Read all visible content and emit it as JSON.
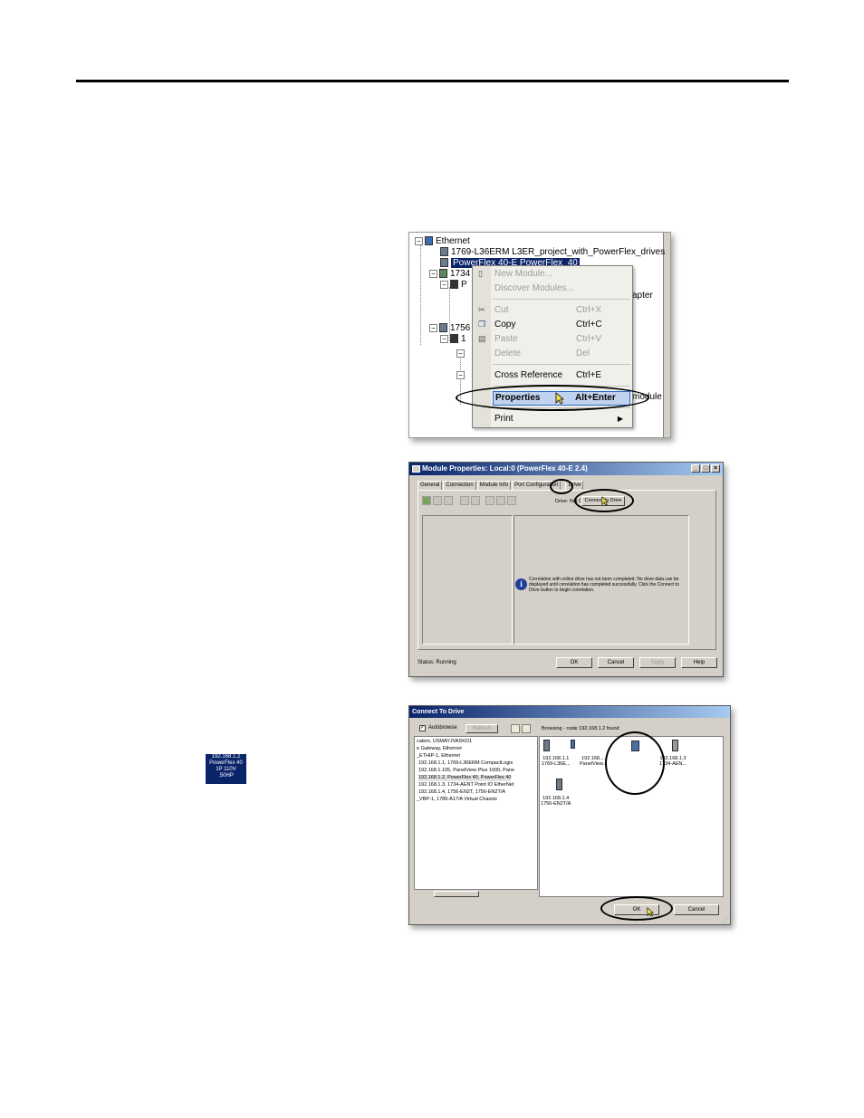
{
  "tree": {
    "rows": [
      "Ethernet",
      "1769-L36ERM L3ER_project_with_PowerFlex_drives",
      "PowerFlex 40-E PowerFlex_40",
      "1734",
      "P",
      "apter",
      "1756",
      "1",
      "module"
    ]
  },
  "context_menu": {
    "items": [
      {
        "label": "New Module...",
        "shortcut": ""
      },
      {
        "label": "Discover Modules...",
        "shortcut": ""
      },
      {
        "label": "Cut",
        "shortcut": "Ctrl+X"
      },
      {
        "label": "Copy",
        "shortcut": "Ctrl+C"
      },
      {
        "label": "Paste",
        "shortcut": "Ctrl+V"
      },
      {
        "label": "Delete",
        "shortcut": "Del"
      },
      {
        "label": "Cross Reference",
        "shortcut": "Ctrl+E"
      },
      {
        "label": "Properties",
        "shortcut": "Alt+Enter"
      },
      {
        "label": "Print",
        "shortcut": ""
      }
    ]
  },
  "module_properties": {
    "title": "Module Properties: Local:0 (PowerFlex 40-E 2.4)",
    "tabs": [
      "General",
      "Connection",
      "Module Info",
      "Port Configuration",
      "Drive"
    ],
    "drive_status": "Drive: Not Connected",
    "connect_button": "Connect to Drive",
    "info_message": "Correlation with online drive has not been completed. No drive data can be displayed until correlation has completed successfully. Click the Connect to Drive button to begin correlation.",
    "status_label": "Status:",
    "status_value": "Running",
    "buttons": {
      "ok": "OK",
      "cancel": "Cancel",
      "apply": "Apply",
      "help": "Help"
    }
  },
  "connect_to_drive": {
    "title": "Connect To Drive",
    "autobrowse_label": "Autobrowse",
    "refresh_label": "Refresh",
    "browsing_status": "Browsing - node 192.168.1.2 found",
    "list_rows": [
      "cation, USMAYJVASKO1",
      "e Gateway, Ethernet",
      "_ETHIP-1, Ethernet",
      "192.168.1.1, 1769-L36ERM CompactLogix",
      "192.168.1.105, PanelView Plus 1000, Pane",
      "192.168.1.2, PowerFlex 40, PowerFlex 40",
      "192.168.1.3, 1734-AENT Point IO EtherNet",
      "192.168.1.4, 1756-EN2T, 1756-EN2T/A",
      "_VBP-1, 1789-A17/A Virtual Chassis"
    ],
    "devices": [
      {
        "line1": "192.168.1.1",
        "line2": "1769-L36E..."
      },
      {
        "line1": "192.168....",
        "line2": "PanelView..."
      },
      {
        "line1": "192.168.1.3",
        "line2": "1734-AEN..."
      },
      {
        "line1": "192.168.1.4",
        "line2": "1756-EN2T/A"
      }
    ],
    "selected_device": [
      "192.168.1.2",
      "PowerFlex 40",
      "1P 110V",
      ".50HP"
    ],
    "buttons": {
      "ok": "OK",
      "cancel": "Cancel"
    }
  }
}
